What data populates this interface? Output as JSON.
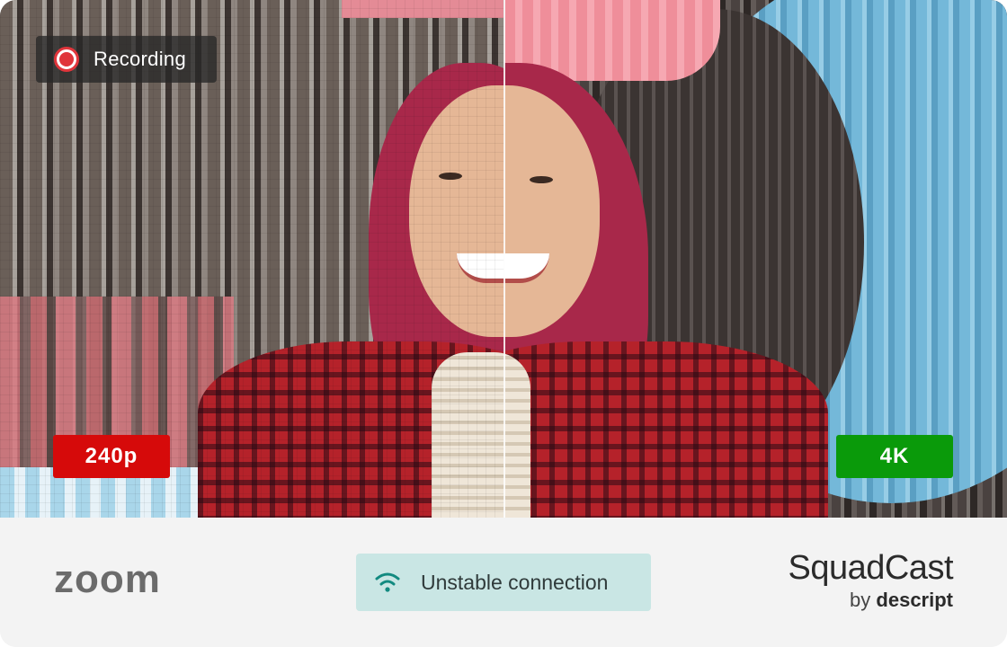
{
  "recording": {
    "label": "Recording",
    "icon": "record-icon",
    "dot_color": "#e0353b"
  },
  "badges": {
    "left": {
      "label": "240p",
      "color": "#d60a0a"
    },
    "right": {
      "label": "4K",
      "color": "#0a9a0a"
    }
  },
  "footer": {
    "left_logo": "zoom",
    "connection": {
      "label": "Unstable connection",
      "icon": "wifi-icon",
      "bg_color": "#c9e6e4",
      "icon_color": "#128a80"
    },
    "brand": {
      "name": "SquadCast",
      "by": "by",
      "sub": "descript"
    }
  }
}
